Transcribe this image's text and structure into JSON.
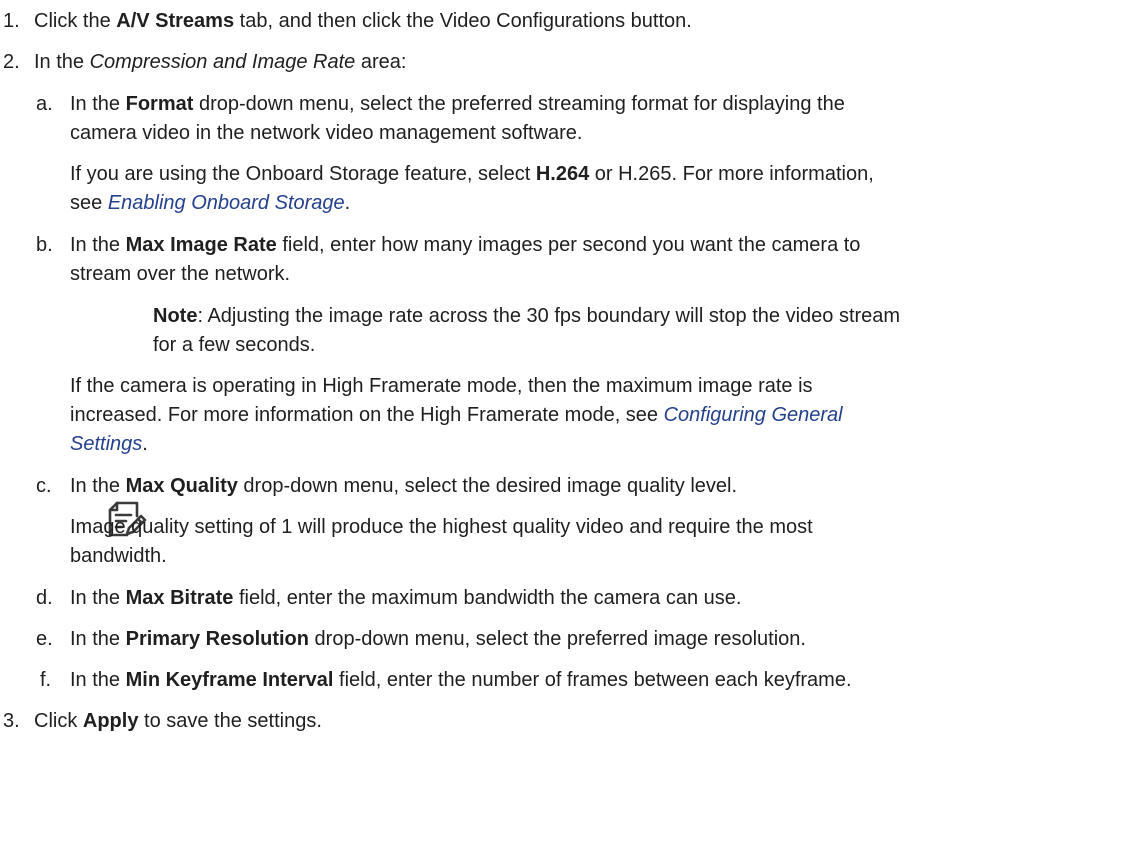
{
  "steps": {
    "s1": {
      "num": "1.",
      "pre": "Click the ",
      "bold": "A/V Streams",
      "post": " tab, and then click the Video Configurations button."
    },
    "s2": {
      "num": "2.",
      "pre": "In the ",
      "italic": "Compression and Image Rate",
      "post": " area:"
    },
    "a": {
      "letter": "a.",
      "l1_pre": "In the ",
      "l1_bold": "Format",
      "l1_post": " drop-down menu, select the preferred streaming format for displaying the",
      "l2": "camera video in the network video management software.",
      "p_pre": "If you are using the Onboard Storage feature, select ",
      "p_bold": "H.264",
      "p_post": " or H.265. For more information,",
      "p2_pre": "see ",
      "p2_link": "Enabling Onboard Storage",
      "p2_post": "."
    },
    "b": {
      "letter": "b.",
      "l1_pre": "In the ",
      "l1_bold": "Max Image Rate",
      "l1_post": " field, enter how many images per second you want the camera to",
      "l2": "stream over the network.",
      "note_bold": "Note",
      "note_l1": ": Adjusting the image rate across the 30 fps boundary will stop the video stream",
      "note_l2": "for a few seconds.",
      "p_l1": "If the camera is operating in High Framerate mode, then the maximum image rate is",
      "p_l2_pre": "increased. For more information on the High Framerate mode, see ",
      "p_l2_link": "Configuring General",
      "p_l3_link": "Settings",
      "p_l3_post": "."
    },
    "c": {
      "letter": "c.",
      "l1_pre": "In the ",
      "l1_bold": "Max Quality",
      "l1_post": " drop-down menu, select the desired image quality level.",
      "p_l1": "Image quality setting of 1 will produce the highest quality video and require the most",
      "p_l2": "bandwidth."
    },
    "d": {
      "letter": "d.",
      "pre": "In the ",
      "bold": "Max Bitrate",
      "post": " field, enter the maximum bandwidth the camera can use."
    },
    "e": {
      "letter": "e.",
      "pre": "In the ",
      "bold": "Primary Resolution",
      "post": " drop-down menu, select the preferred image resolution."
    },
    "f": {
      "letter": "f.",
      "pre": "In the ",
      "bold": "Min Keyframe Interval",
      "post": " field, enter the number of frames between each keyframe."
    },
    "s3": {
      "num": "3.",
      "pre": "Click ",
      "bold": "Apply",
      "post": " to save the settings."
    }
  },
  "icons": {
    "note": "note-icon"
  }
}
